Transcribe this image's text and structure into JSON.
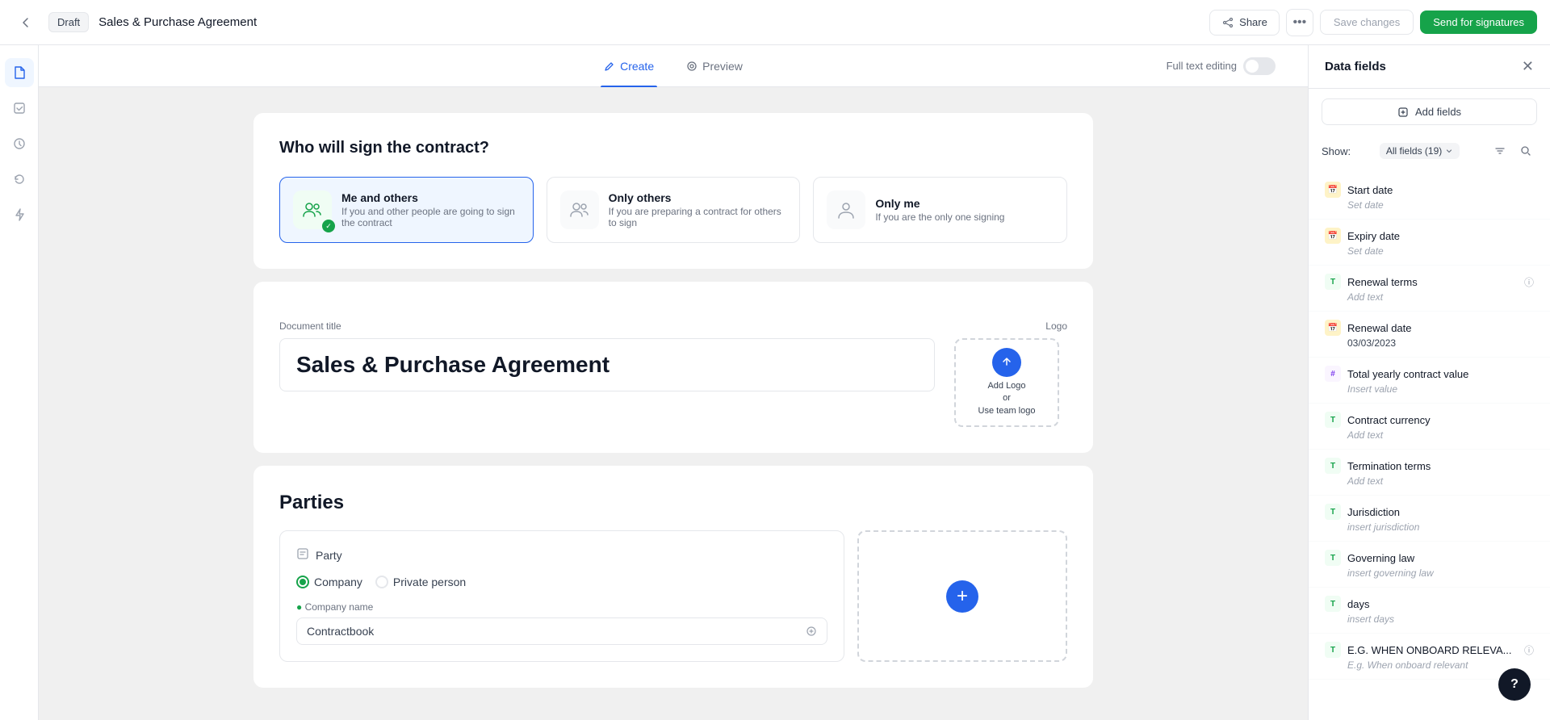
{
  "topbar": {
    "back_label": "←",
    "draft_label": "Draft",
    "doc_title": "Sales & Purchase Agreement",
    "share_label": "Share",
    "more_label": "•••",
    "save_label": "Save changes",
    "send_label": "Send for signatures"
  },
  "tabs": {
    "create_label": "Create",
    "preview_label": "Preview",
    "full_text_editing_label": "Full text editing"
  },
  "who_signs": {
    "title": "Who will sign the contract?",
    "options": [
      {
        "label": "Me and others",
        "desc": "If you and other people are going to sign the contract",
        "selected": true
      },
      {
        "label": "Only others",
        "desc": "If you are preparing a contract for others to sign",
        "selected": false
      },
      {
        "label": "Only me",
        "desc": "If you are the only one signing",
        "selected": false
      }
    ]
  },
  "document": {
    "title_label": "Document title",
    "title_value": "Sales & Purchase Agreement",
    "logo_label": "Logo",
    "logo_add": "Add Logo",
    "logo_or": "or",
    "logo_team": "Use team logo"
  },
  "parties": {
    "title": "Parties",
    "party_label": "Party",
    "company_label": "Company",
    "private_label": "Private person",
    "company_name_label": "Company name",
    "company_name_value": "Contractbook",
    "add_party_label": "+"
  },
  "right_panel": {
    "title": "Data fields",
    "add_fields_label": "Add fields",
    "show_label": "Show:",
    "show_filter": "All fields (19)",
    "fields": [
      {
        "type": "date",
        "name": "Start date",
        "value": "Set date",
        "is_placeholder": true
      },
      {
        "type": "date",
        "name": "Expiry date",
        "value": "Set date",
        "is_placeholder": true
      },
      {
        "type": "text",
        "name": "Renewal terms",
        "value": "Add text",
        "is_placeholder": true,
        "has_info": true
      },
      {
        "type": "date",
        "name": "Renewal date",
        "value": "03/03/2023",
        "is_placeholder": false
      },
      {
        "type": "num",
        "name": "Total yearly contract value",
        "value": "Insert value",
        "is_placeholder": true
      },
      {
        "type": "text",
        "name": "Contract currency",
        "value": "Add text",
        "is_placeholder": true
      },
      {
        "type": "text",
        "name": "Termination terms",
        "value": "Add text",
        "is_placeholder": true
      },
      {
        "type": "text",
        "name": "Jurisdiction",
        "value": "insert jurisdiction",
        "is_placeholder": true
      },
      {
        "type": "text",
        "name": "Governing law",
        "value": "insert governing law",
        "is_placeholder": true
      },
      {
        "type": "text",
        "name": "days",
        "value": "insert days",
        "is_placeholder": true
      },
      {
        "type": "text",
        "name": "E.G. WHEN ONBOARD RELEVA...",
        "value": "E.g. When onboard relevant",
        "is_placeholder": true,
        "has_info": true
      }
    ]
  },
  "help": {
    "label": "?"
  }
}
